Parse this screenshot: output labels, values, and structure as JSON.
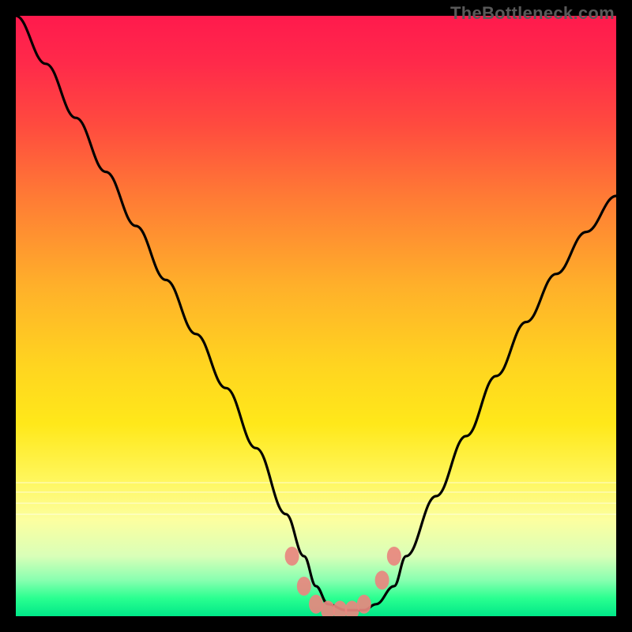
{
  "watermark": "TheBottleneck.com",
  "chart_data": {
    "type": "line",
    "title": "",
    "xlabel": "",
    "ylabel": "",
    "xlim": [
      0,
      100
    ],
    "ylim": [
      0,
      100
    ],
    "series": [
      {
        "name": "curve",
        "x": [
          0,
          5,
          10,
          15,
          20,
          25,
          30,
          35,
          40,
          45,
          48,
          50,
          52,
          55,
          58,
          60,
          63,
          65,
          70,
          75,
          80,
          85,
          90,
          95,
          100
        ],
        "values": [
          100,
          92,
          83,
          74,
          65,
          56,
          47,
          38,
          28,
          17,
          10,
          5,
          2,
          1,
          1,
          2,
          5,
          10,
          20,
          30,
          40,
          49,
          57,
          64,
          70
        ]
      }
    ],
    "markers": {
      "color": "#e8877f",
      "approx_points_x": [
        46,
        48,
        50,
        52,
        54,
        56,
        58,
        61,
        63
      ],
      "approx_points_y": [
        10,
        5,
        2,
        1,
        1,
        1,
        2,
        6,
        10
      ]
    },
    "gradient_stops": [
      {
        "pos": 0.0,
        "color": "#ff1a4d"
      },
      {
        "pos": 0.18,
        "color": "#ff4a3f"
      },
      {
        "pos": 0.45,
        "color": "#ffb02a"
      },
      {
        "pos": 0.68,
        "color": "#ffe81a"
      },
      {
        "pos": 0.85,
        "color": "#fcffa0"
      },
      {
        "pos": 0.94,
        "color": "#88ffb0"
      },
      {
        "pos": 1.0,
        "color": "#00e888"
      }
    ]
  }
}
